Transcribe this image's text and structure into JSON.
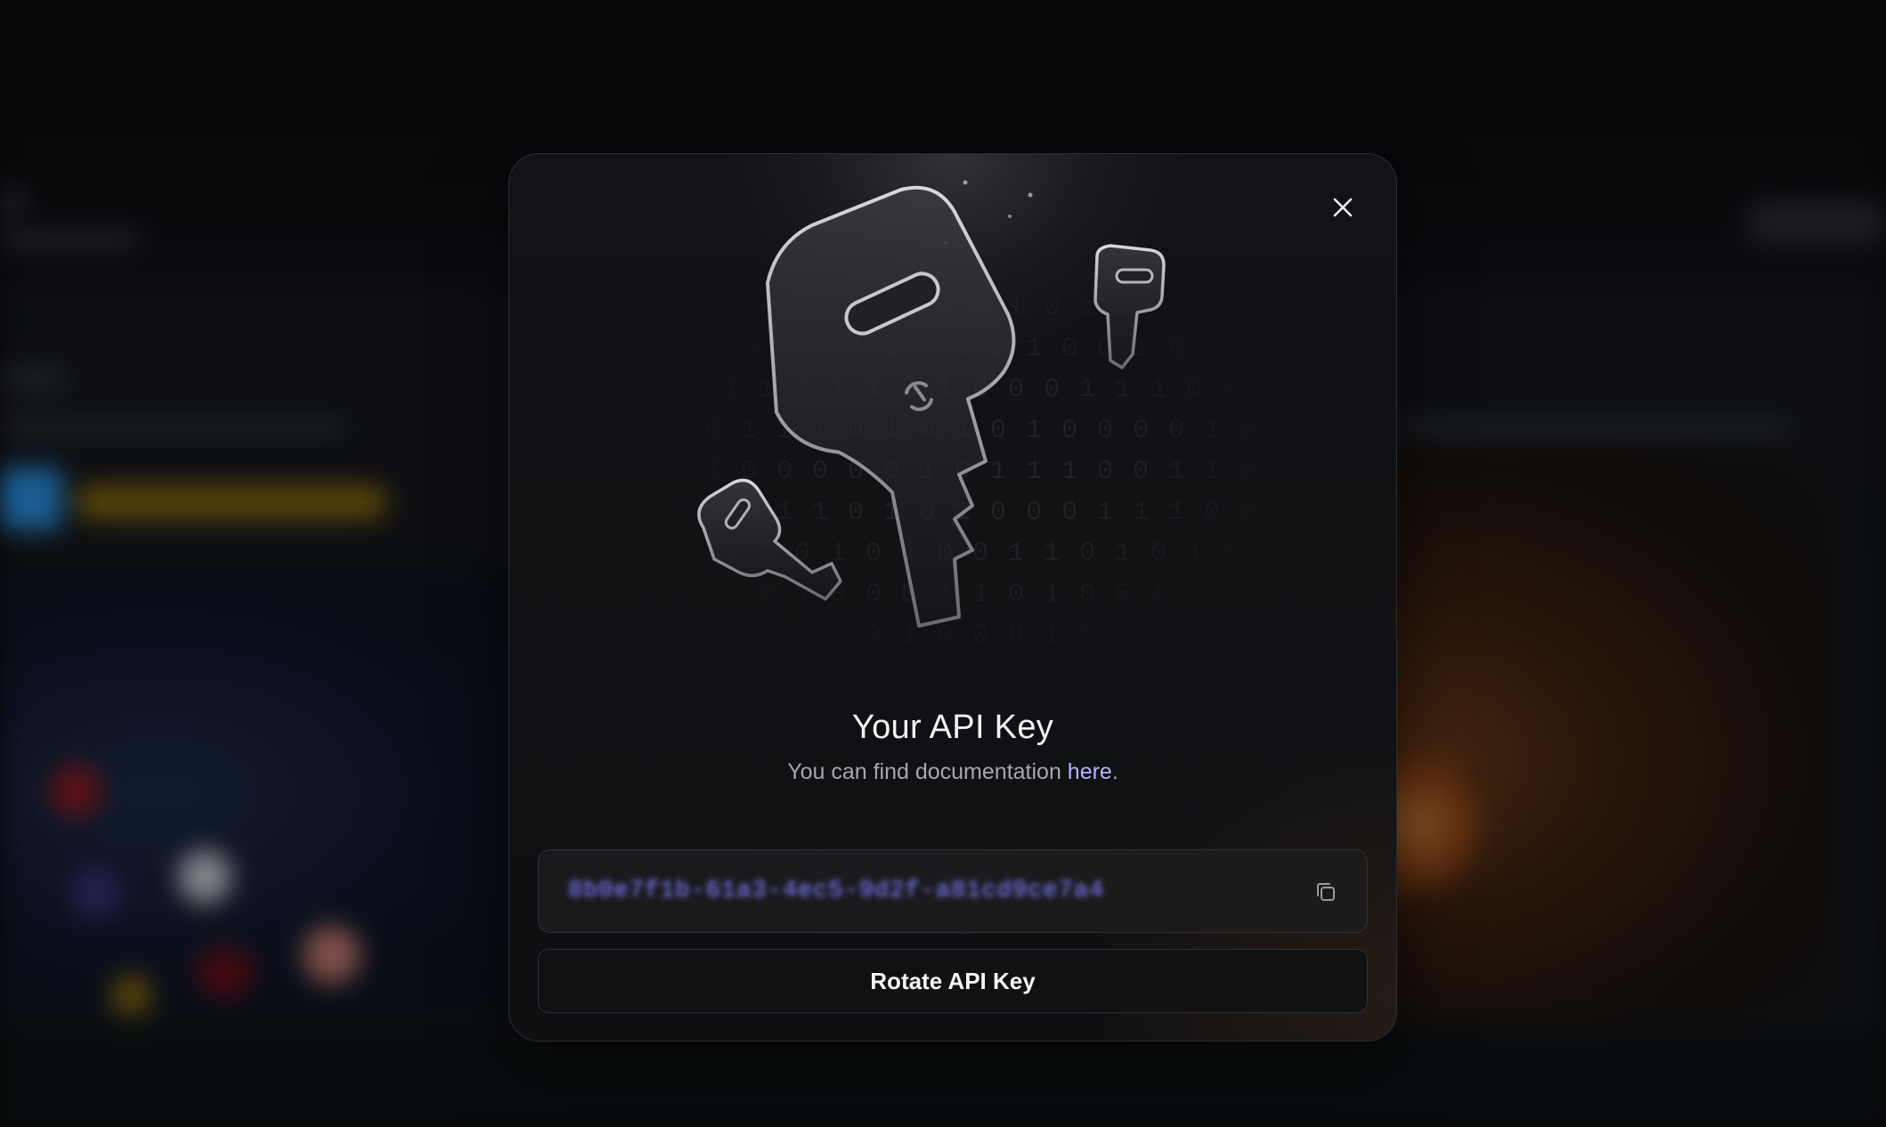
{
  "modal": {
    "title": "Your API Key",
    "subtitle_prefix": "You can find documentation ",
    "subtitle_link": "here",
    "subtitle_suffix": ".",
    "api_key_value": "8b0e7f1b-61a3-4ec5-9d2f-a81cd9ce7a4",
    "api_key_masked": true,
    "rotate_button_label": "Rotate API Key",
    "close_icon": "close-icon",
    "copy_icon": "copy-icon"
  },
  "illustration": {
    "binary_rows": [
      "   0 1 1 0 0 1 1 0 0 1 0 1 1 0 1 1 1 0",
      "  1 0 0 1 1 1 1 0 0 1 1 0 0 1 0 1 0 1 1",
      " 1 1 1 1 1 1 1 0 1 0 0 0 1 1 1 0 0 1 1",
      "1 1 0 1 1 1 0 1 0 1 0 1 0 0 0 0 1 0 0 1 0",
      "0 0 1 0 0 0 0 0 1 0 1 1 1 0 0 1 1 0 1 1 1 0",
      "0 1 0 0 1 1 0 1 0 1 0 0 0 1 1 1 0 0 1 1 0 0 0",
      " 1 1 0 1 0 1 0 1 0 0 1 1 0 1 0 1 1 0 1 1 0 1",
      "   0 1 0 1 0 0 0 1 1 0 1 0 0 1 1 0 1 0 0",
      "     0 1 0 1 0 1 0 0 0 1 0 1 1 1 1 1 0 0",
      "        1 0 0 0 1 1 0 1 0 0 0 0 1 0"
    ]
  },
  "colors": {
    "accent_link": "#b6b4ff",
    "api_key_text": "#6d6fd6",
    "modal_border": "#2c2d31"
  }
}
